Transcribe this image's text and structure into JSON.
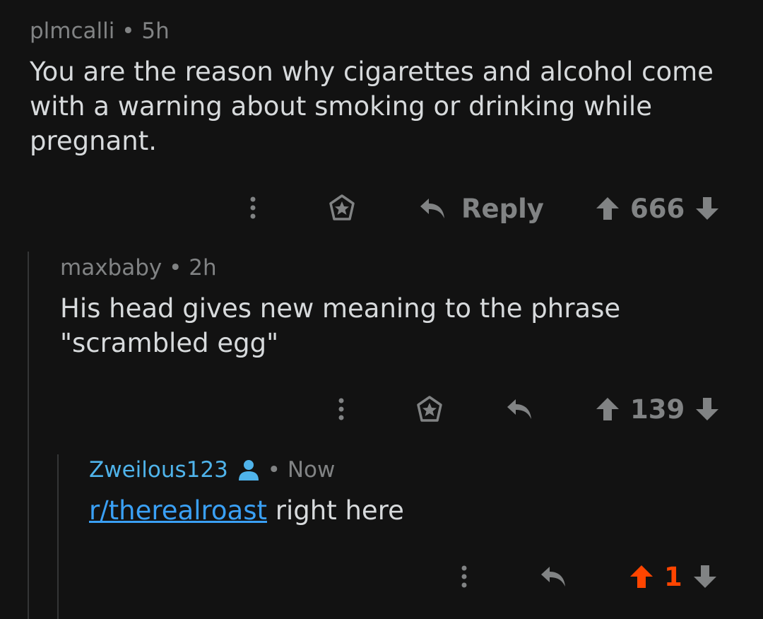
{
  "comments": [
    {
      "user": "plmcalli",
      "sep": " • ",
      "time": "5h",
      "text": "You are the reason why cigarettes and alcohol come with a warning about smoking or drinking while pregnant.",
      "reply_label": "Reply",
      "score": "666"
    },
    {
      "user": "maxbaby",
      "sep": " • ",
      "time": "2h",
      "text": "His head gives new meaning to the phrase \"scrambled egg\"",
      "score": "139"
    },
    {
      "user": "Zweilous123",
      "sep": " • ",
      "time": "Now",
      "link_text": "r/therealroast",
      "text_after_link": " right here",
      "score": "1"
    }
  ],
  "colors": {
    "background": "#121212",
    "text": "#d7dadc",
    "muted": "#818384",
    "user_highlight": "#4fb3ea",
    "upvote_active": "#ff4500",
    "link": "#3aa0f5"
  },
  "icons": [
    "more-vertical-icon",
    "award-icon",
    "reply-arrow-icon",
    "upvote-arrow-icon",
    "downvote-arrow-icon",
    "user-icon"
  ]
}
